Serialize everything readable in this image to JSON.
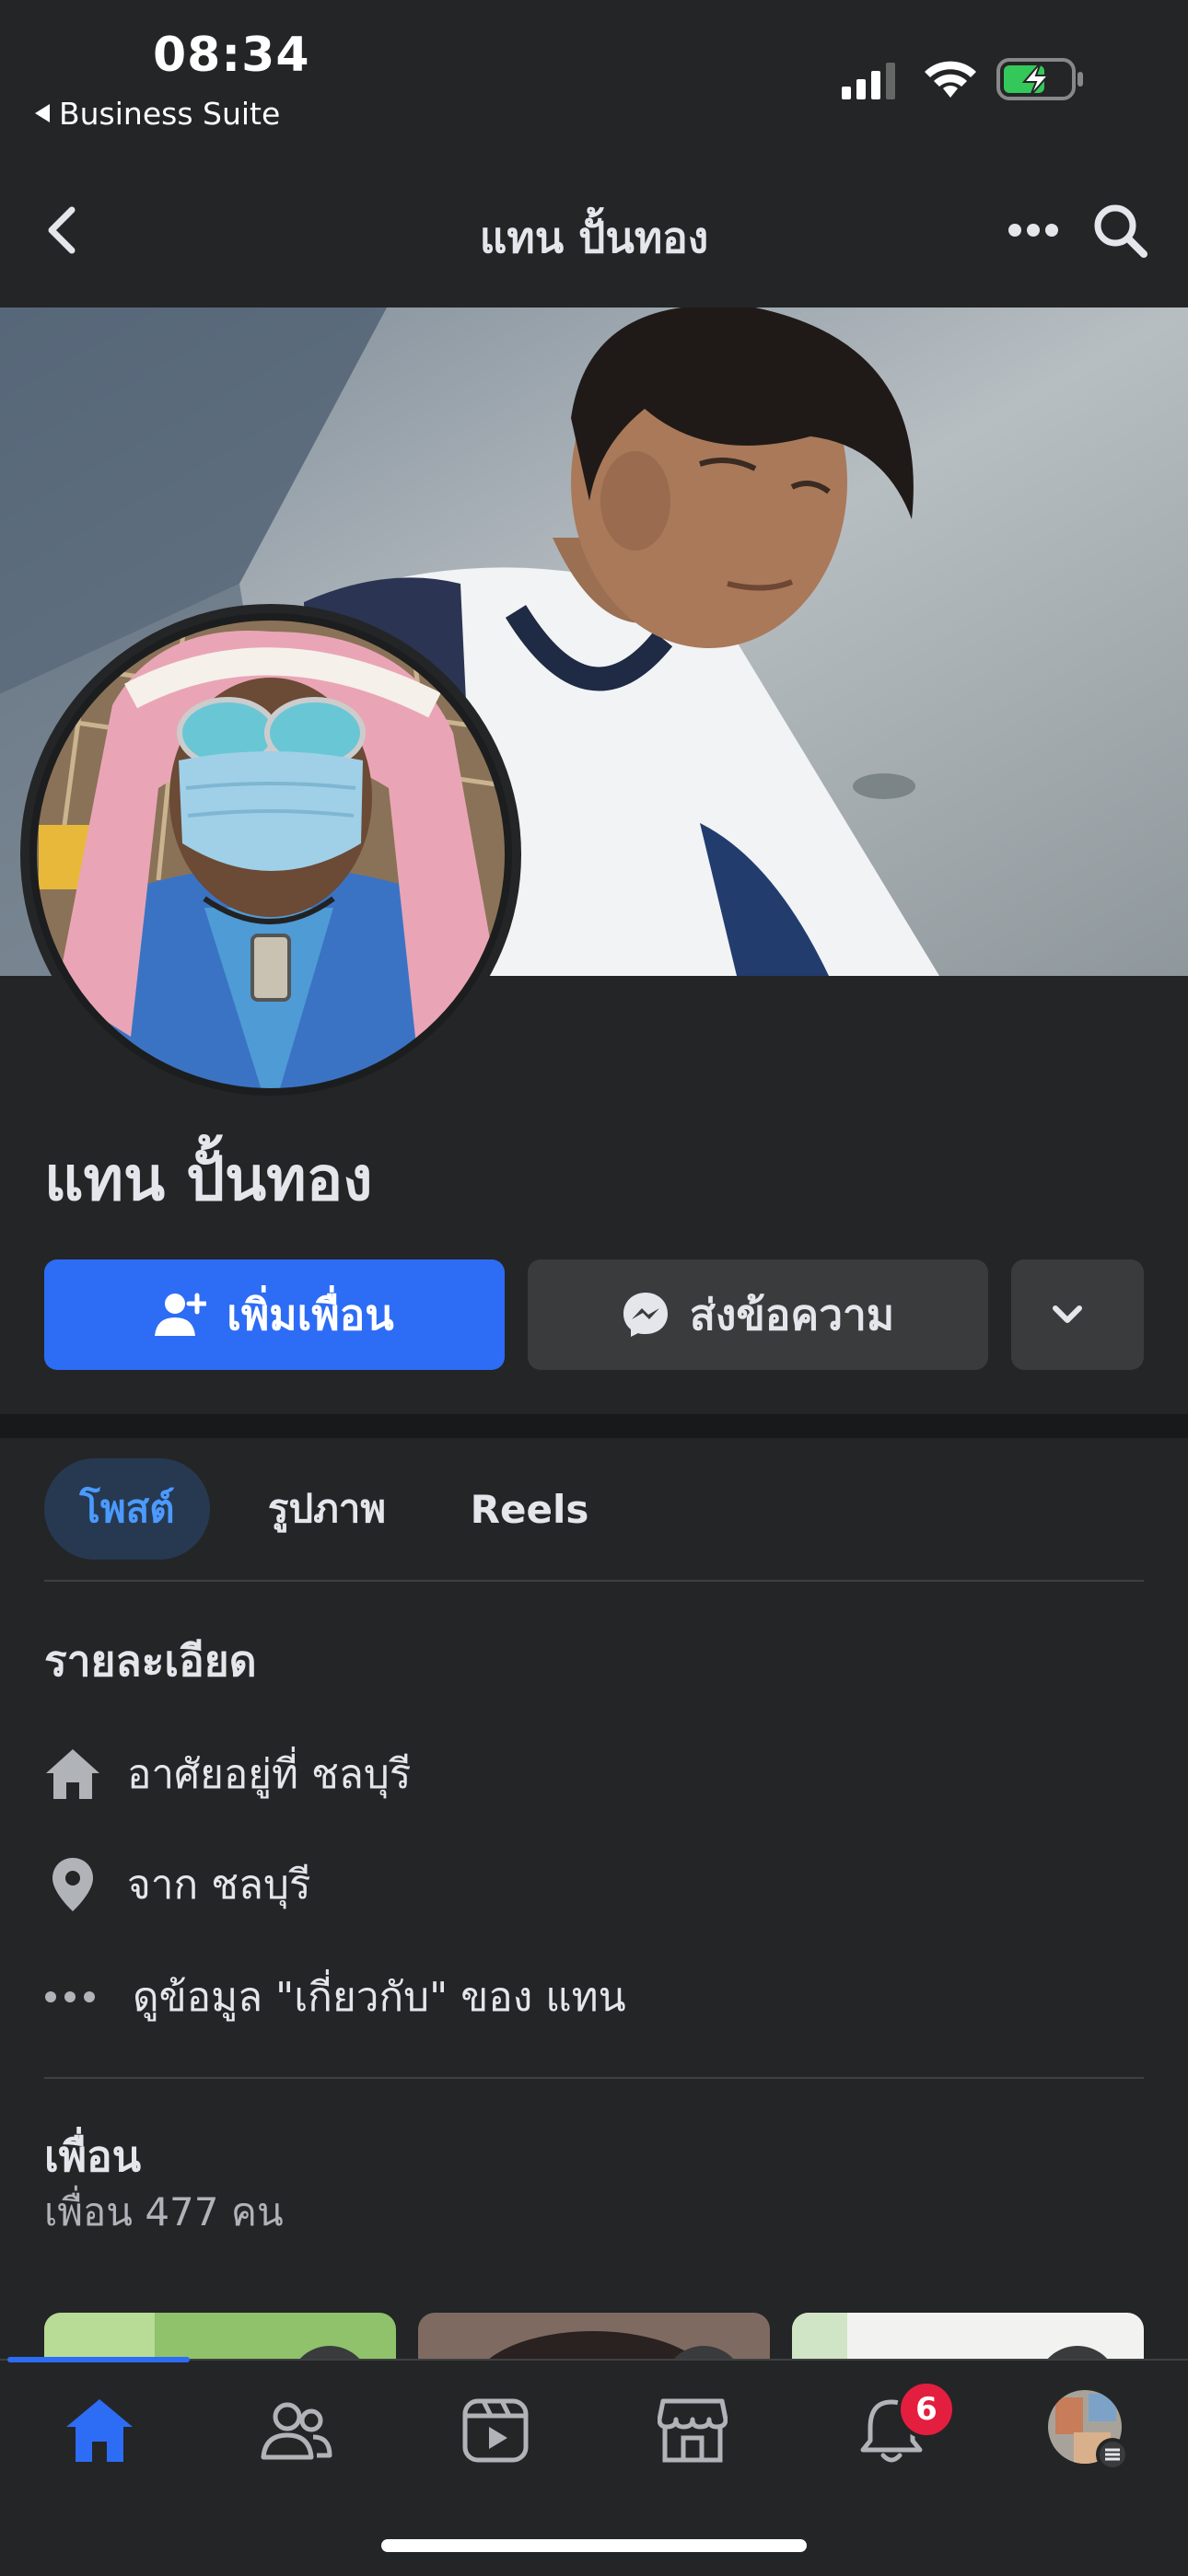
{
  "status_bar": {
    "time": "08:34",
    "back_app": "Business Suite",
    "icons": [
      "signal-icon",
      "wifi-icon",
      "battery-charging-icon"
    ]
  },
  "header": {
    "title": "แทน ปั้นทอง",
    "icons": [
      "back-icon",
      "more-icon",
      "search-icon"
    ]
  },
  "profile": {
    "name": "แทน ปั้นทอง"
  },
  "actions": {
    "add_friend": "เพิ่มเพื่อน",
    "message": "ส่งข้อความ"
  },
  "tabs": [
    {
      "label": "โพสต์",
      "active": true
    },
    {
      "label": "รูปภาพ",
      "active": false
    },
    {
      "label": "Reels",
      "active": false
    }
  ],
  "details": {
    "title": "รายละเอียด",
    "lives_in": "อาศัยอยู่ที่ ชลบุรี",
    "from": "จาก ชลบุรี",
    "about": "ดูข้อมูล \"เกี่ยวกับ\" ของ แทน"
  },
  "friends": {
    "title": "เพื่อน",
    "count": "เพื่อน 477 คน"
  },
  "bottom_nav": {
    "items": [
      "home-icon",
      "friends-icon",
      "video-icon",
      "marketplace-icon",
      "notifications-icon",
      "profile-menu-icon"
    ],
    "notification_badge": "6"
  },
  "colors": {
    "accent": "#2d6cf5",
    "background": "#242526",
    "badge": "#e41e3f"
  }
}
